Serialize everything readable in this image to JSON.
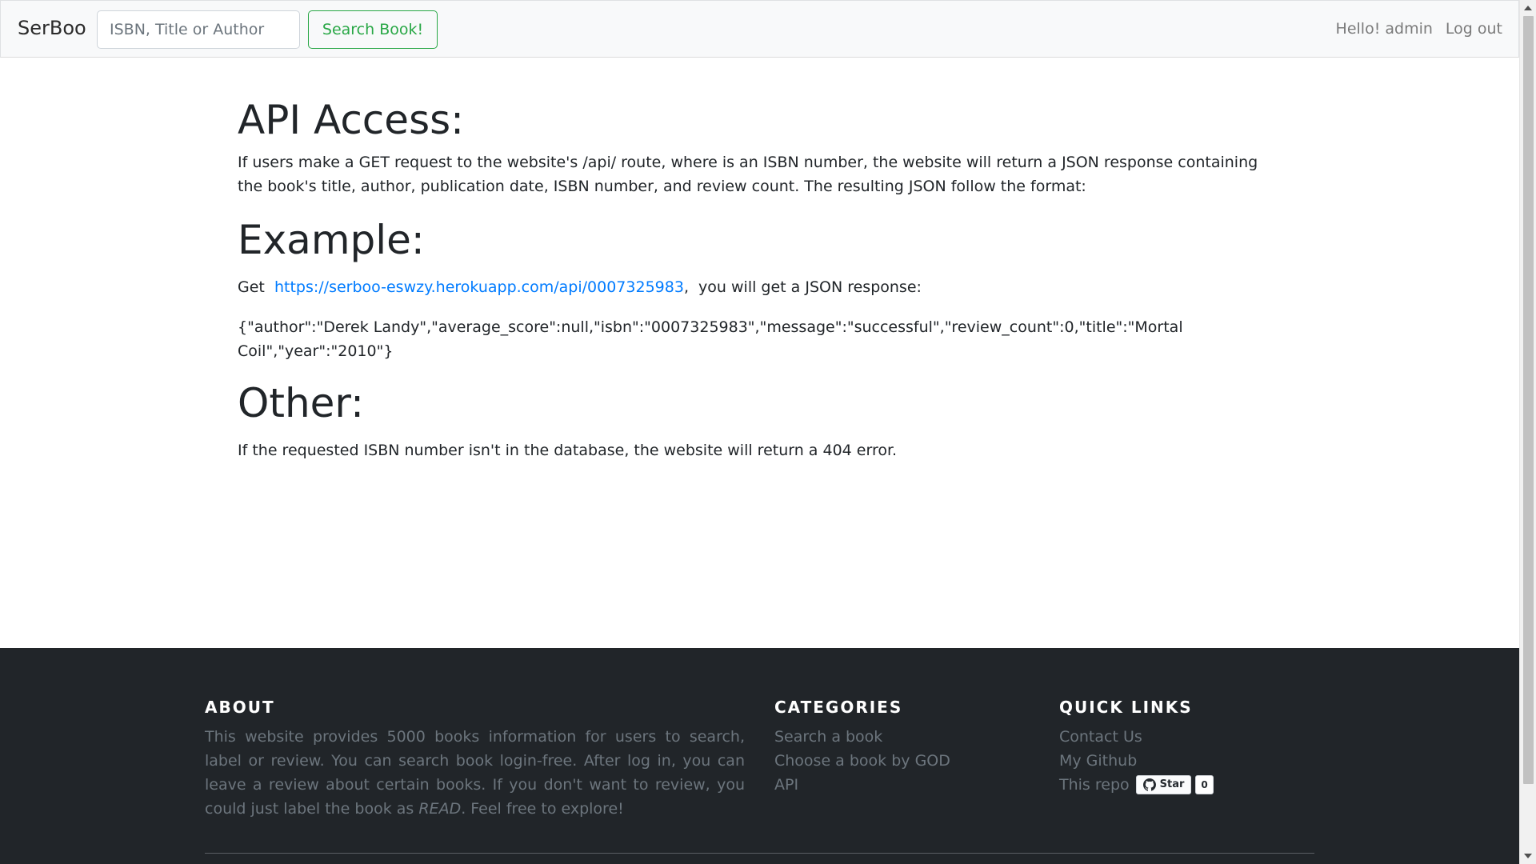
{
  "navbar": {
    "brand": "SerBoo",
    "search_placeholder": "ISBN, Title or Author",
    "search_button": "Search Book!",
    "greeting": "Hello! admin",
    "logout": "Log out"
  },
  "main": {
    "api_heading": "API Access:",
    "api_text": "If users make a GET request to the website's /api/ route, where is an ISBN number, the website will return a JSON response containing the book's title, author, publication date, ISBN number, and review count. The resulting JSON follow the format:",
    "example_heading": "Example:",
    "example_prefix": "Get",
    "example_link": "https://serboo-eswzy.herokuapp.com/api/0007325983",
    "example_suffix": ",  you will get a JSON response:",
    "example_json": "{\"author\":\"Derek Landy\",\"average_score\":null,\"isbn\":\"0007325983\",\"message\":\"successful\",\"review_count\":0,\"title\":\"Mortal Coil\",\"year\":\"2010\"}",
    "other_heading": "Other:",
    "other_text": "If the requested ISBN number isn't in the database, the website will return a 404 error."
  },
  "footer": {
    "about": {
      "heading": "ABOUT",
      "text_before": "This website provides 5000 books information for users to search, label or review. You can search book login-free. After log in, you can leave a review about certain books. If you don't want to review, you could just label the book as ",
      "text_emph": "READ",
      "text_after": ". Feel free to explore!"
    },
    "categories": {
      "heading": "CATEGORIES",
      "items": [
        "Search a book",
        "Choose a book by GOD",
        "API"
      ]
    },
    "quick_links": {
      "heading": "QUICK LINKS",
      "contact": "Contact Us",
      "github": "My Github",
      "repo_label": "This repo",
      "star_label": "Star",
      "star_count": "0"
    }
  },
  "icons": {
    "github": "github-icon"
  }
}
